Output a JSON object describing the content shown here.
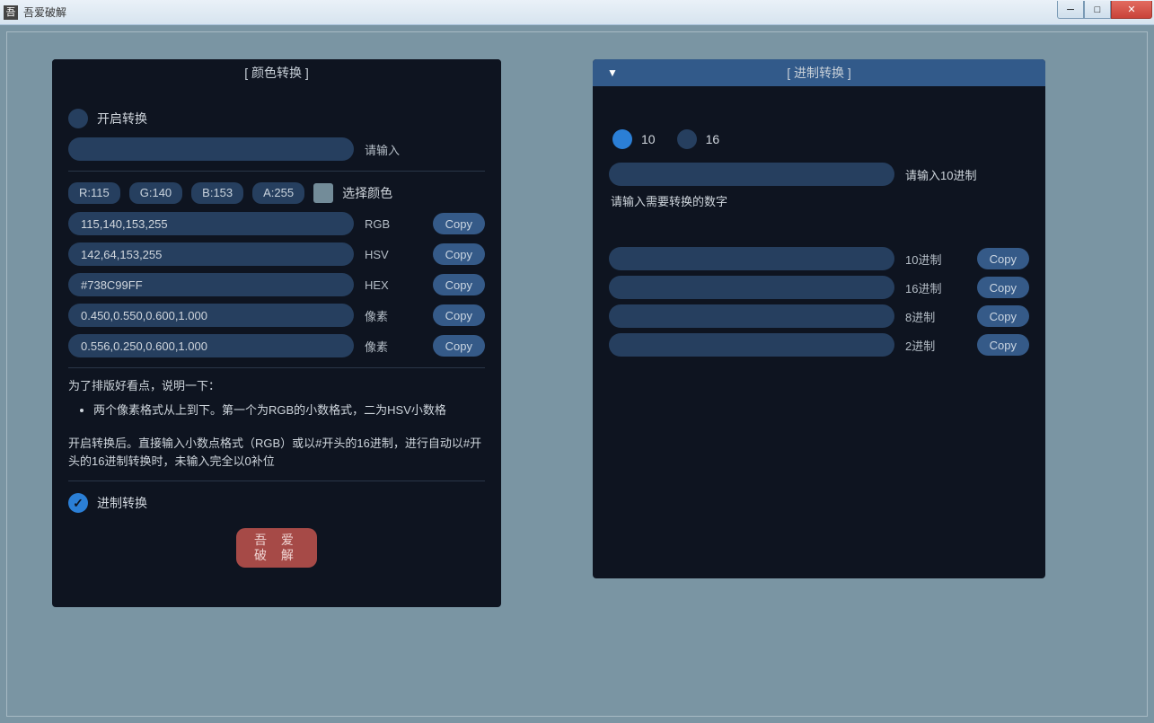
{
  "window": {
    "title": "吾爱破解",
    "icon_char": "吾"
  },
  "left": {
    "title": "[ 颜色转换 ]",
    "start_label": "开启转换",
    "input_placeholder": "请输入",
    "r": "R:115",
    "g": "G:140",
    "b": "B:153",
    "a": "A:255",
    "select_color": "选择颜色",
    "swatch_hex": "#738C99",
    "rows": [
      {
        "value": "115,140,153,255",
        "label": "RGB",
        "copy": "Copy"
      },
      {
        "value": "142,64,153,255",
        "label": "HSV",
        "copy": "Copy"
      },
      {
        "value": "#738C99FF",
        "label": "HEX",
        "copy": "Copy"
      },
      {
        "value": "0.450,0.550,0.600,1.000",
        "label": "像素",
        "copy": "Copy"
      },
      {
        "value": "0.556,0.250,0.600,1.000",
        "label": "像素",
        "copy": "Copy"
      }
    ],
    "desc_intro": "为了排版好看点，说明一下：",
    "desc_bullet": "两个像素格式从上到下。第一个为RGB的小数格式，二为HSV小数格",
    "desc_para": "开启转换后。直接输入小数点格式（RGB）或以#开头的16进制，进行自动以#开头的16进制转换时，未输入完全以0补位",
    "base_conv_label": "进制转换",
    "red_btn_line1": "吾 爱",
    "red_btn_line2": "破 解"
  },
  "right": {
    "title": "[ 进制转换 ]",
    "radio10": "10",
    "radio16": "16",
    "input_label_after": "请输入10进制",
    "help": "请输入需要转换的数字",
    "rows": [
      {
        "label": "10进制",
        "copy": "Copy"
      },
      {
        "label": "16进制",
        "copy": "Copy"
      },
      {
        "label": "8进制",
        "copy": "Copy"
      },
      {
        "label": "2进制",
        "copy": "Copy"
      }
    ]
  }
}
